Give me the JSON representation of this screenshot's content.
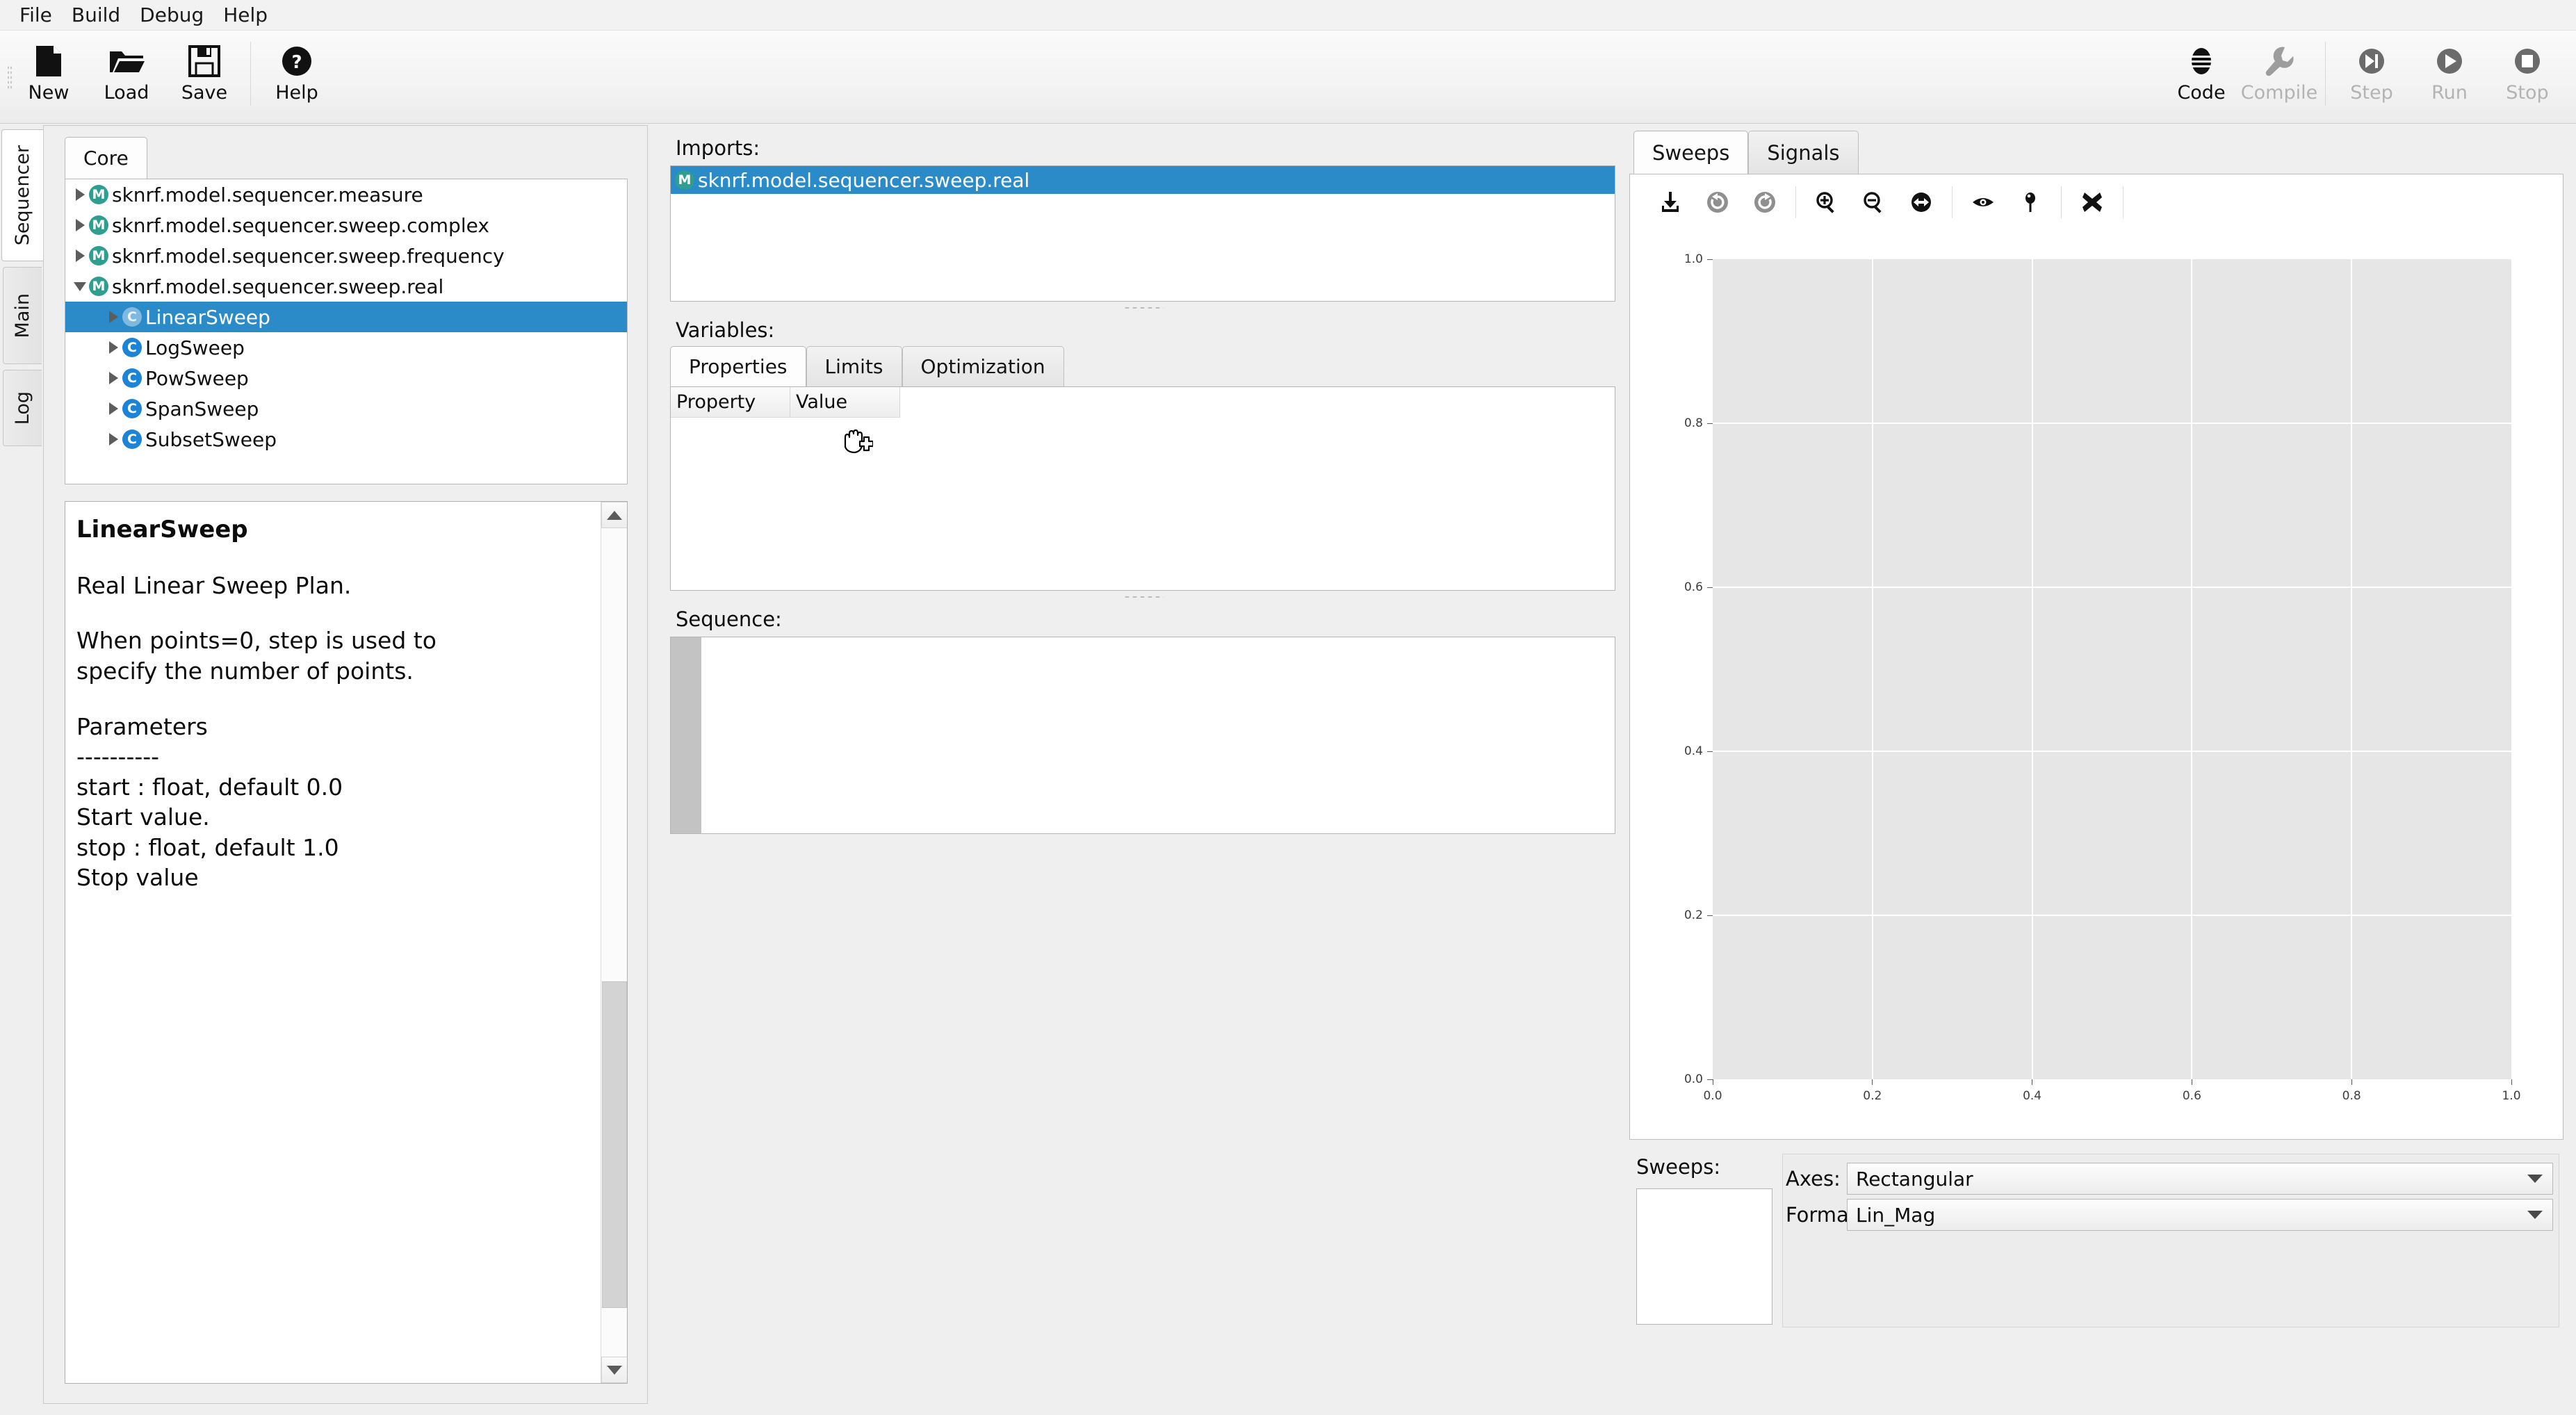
{
  "menubar": {
    "items": [
      "File",
      "Build",
      "Debug",
      "Help"
    ]
  },
  "toolbar": {
    "left": [
      {
        "label": "New",
        "icon": "new-file-icon",
        "enabled": true
      },
      {
        "label": "Load",
        "icon": "open-folder-icon",
        "enabled": true
      },
      {
        "label": "Save",
        "icon": "save-disk-icon",
        "enabled": true
      },
      {
        "label": "Help",
        "icon": "help-circle-icon",
        "enabled": true
      }
    ],
    "right": [
      {
        "label": "Code",
        "icon": "code-icon",
        "enabled": true
      },
      {
        "label": "Compile",
        "icon": "wrench-icon",
        "enabled": false
      },
      {
        "label": "Step",
        "icon": "step-icon",
        "enabled": false
      },
      {
        "label": "Run",
        "icon": "play-icon",
        "enabled": false
      },
      {
        "label": "Stop",
        "icon": "stop-icon",
        "enabled": false
      }
    ]
  },
  "vertical_tabs": [
    {
      "label": "Sequencer",
      "selected": true
    },
    {
      "label": "Main",
      "selected": false
    },
    {
      "label": "Log",
      "selected": false
    }
  ],
  "left_panel": {
    "tabs": [
      {
        "label": "Core",
        "selected": true
      }
    ],
    "tree": [
      {
        "label": "sknrf.model.sequencer.measure",
        "kind": "M",
        "indent": 0,
        "expanded": false,
        "selected": false
      },
      {
        "label": "sknrf.model.sequencer.sweep.complex",
        "kind": "M",
        "indent": 0,
        "expanded": false,
        "selected": false
      },
      {
        "label": "sknrf.model.sequencer.sweep.frequency",
        "kind": "M",
        "indent": 0,
        "expanded": false,
        "selected": false
      },
      {
        "label": "sknrf.model.sequencer.sweep.real",
        "kind": "M",
        "indent": 0,
        "expanded": true,
        "selected": false
      },
      {
        "label": "LinearSweep",
        "kind": "C",
        "indent": 1,
        "expanded": false,
        "selected": true
      },
      {
        "label": "LogSweep",
        "kind": "C",
        "indent": 1,
        "expanded": false,
        "selected": false
      },
      {
        "label": "PowSweep",
        "kind": "C",
        "indent": 1,
        "expanded": false,
        "selected": false
      },
      {
        "label": "SpanSweep",
        "kind": "C",
        "indent": 1,
        "expanded": false,
        "selected": false
      },
      {
        "label": "SubsetSweep",
        "kind": "C",
        "indent": 1,
        "expanded": false,
        "selected": false
      }
    ],
    "doc": {
      "title": "LinearSweep",
      "lines": [
        "Real Linear Sweep Plan.",
        "",
        "When points=0, step is used to",
        "specify the number of points.",
        "",
        "Parameters",
        "----------",
        "start : float, default 0.0",
        "Start value.",
        "stop : float, default 1.0",
        "Stop value"
      ]
    }
  },
  "center_panel": {
    "imports_label": "Imports:",
    "imports": [
      {
        "label": "sknrf.model.sequencer.sweep.real",
        "kind": "M",
        "selected": true
      }
    ],
    "variables_label": "Variables:",
    "variables_tabs": [
      {
        "label": "Properties",
        "selected": true
      },
      {
        "label": "Limits",
        "selected": false
      },
      {
        "label": "Optimization",
        "selected": false
      }
    ],
    "variables_columns": [
      "Property",
      "Value"
    ],
    "variables_rows": [],
    "cursor_icon": "drag-drop-hand-plus-cursor",
    "sequence_label": "Sequence:",
    "sequence_rows": []
  },
  "right_panel": {
    "tabs": [
      {
        "label": "Sweeps",
        "selected": true
      },
      {
        "label": "Signals",
        "selected": false
      }
    ],
    "plot_toolbar": [
      {
        "icon": "download-icon",
        "enabled": true
      },
      {
        "icon": "undo-icon",
        "enabled": false
      },
      {
        "icon": "redo-icon",
        "enabled": false
      },
      {
        "icon": "zoom-in-icon",
        "enabled": true
      },
      {
        "icon": "zoom-out-icon",
        "enabled": true
      },
      {
        "icon": "pan-icon",
        "enabled": true
      },
      {
        "icon": "eye-icon",
        "enabled": true
      },
      {
        "icon": "marker-pin-icon",
        "enabled": true
      },
      {
        "icon": "clear-x-icon",
        "enabled": true
      }
    ],
    "sweeps_label": "Sweeps:",
    "sweeps_list": [],
    "axes_label": "Axes:",
    "axes_value": "Rectangular",
    "format_label": "Format:",
    "format_value": "Lin_Mag"
  },
  "chart_data": {
    "type": "line",
    "title": "",
    "xlabel": "",
    "ylabel": "",
    "xlim": [
      0.0,
      1.0
    ],
    "ylim": [
      0.0,
      1.0
    ],
    "xticks": [
      "0.0",
      "0.2",
      "0.4",
      "0.6",
      "0.8",
      "1.0"
    ],
    "yticks": [
      "0.0",
      "0.2",
      "0.4",
      "0.6",
      "0.8",
      "1.0"
    ],
    "grid": true,
    "legend": "none",
    "series": [],
    "plot_bg": "#e6e6e6",
    "grid_color": "#ffffff"
  }
}
